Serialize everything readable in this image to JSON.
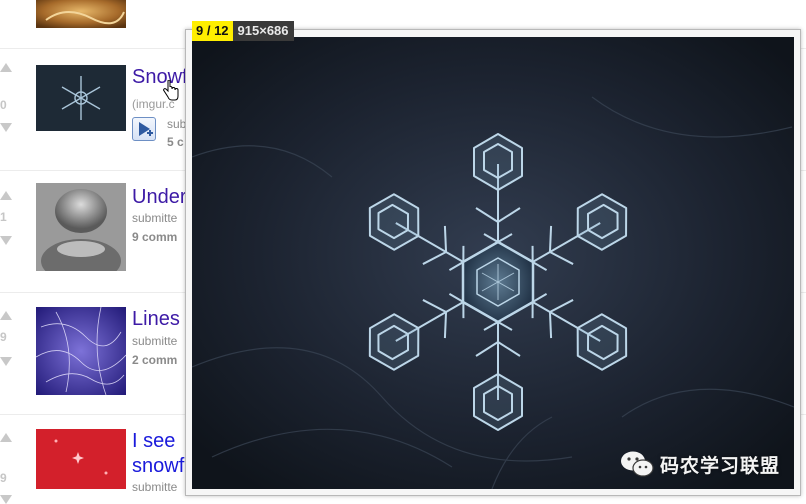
{
  "posts": [
    {
      "score": "",
      "title": "",
      "domain": "",
      "submitted": "",
      "comments": ""
    },
    {
      "score": "0",
      "title": "Snowf",
      "domain": "(imgur.c",
      "submitted": "submitt",
      "comments": "5 c"
    },
    {
      "score": "1",
      "title": "Under",
      "domain": "",
      "submitted": "submitte",
      "comments": "9 comm"
    },
    {
      "score": "9",
      "title": "Lines",
      "domain": "",
      "submitted": "submitte",
      "comments": "2 comm"
    },
    {
      "score": "9",
      "title": "I see",
      "title2": "snowf",
      "domain": "",
      "submitted": "submitte",
      "comments": ""
    }
  ],
  "viewer": {
    "counter": "9 / 12",
    "dimensions": "915×686"
  },
  "watermark": {
    "text": "码农学习联盟"
  },
  "icons": {
    "expando": "image-expand-icon",
    "cursor": "hand-pointer-icon",
    "upvote": "upvote-arrow-icon",
    "downvote": "downvote-arrow-icon",
    "wechat": "wechat-logo-icon"
  },
  "colors": {
    "title_visited": "#3d1aa6",
    "title_unvisited": "#1a1adb",
    "badge_counter": "#ffee00",
    "badge_dims": "#3a3a3a"
  }
}
